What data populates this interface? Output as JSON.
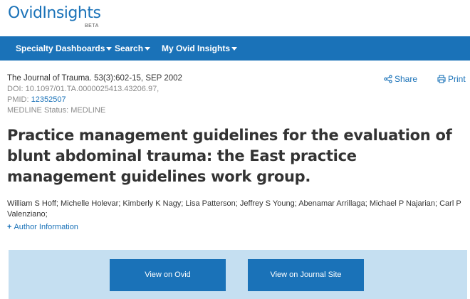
{
  "logo": {
    "text": "OvidInsights",
    "badge": "BETA"
  },
  "nav": {
    "items": [
      {
        "label": "Specialty Dashboards"
      },
      {
        "label": "Search"
      },
      {
        "label": "My Ovid Insights"
      }
    ]
  },
  "citation": {
    "journal": "The Journal of Trauma. 53(3):602-15, SEP 2002",
    "doi": "DOI: 10.1097/01.TA.0000025413.43206.97,",
    "pmid_label": "PMID:",
    "pmid_value": "12352507",
    "medline_status": "MEDLINE Status: MEDLINE"
  },
  "actions": {
    "share_label": "Share",
    "print_label": "Print"
  },
  "article": {
    "title": "Practice management guidelines for the evaluation of blunt abdominal trauma: the East practice management guidelines work group.",
    "authors": "William S Hoff; Michelle Holevar; Kimberly K Nagy; Lisa Patterson; Jeffrey S Young; Abenamar Arrillaga; Michael P Najarian; Carl P Valenziano;",
    "author_info_label": "Author Information"
  },
  "buttons": {
    "view_on_ovid": "View on Ovid",
    "view_on_journal": "View on Journal Site"
  },
  "colors": {
    "brand": "#1a72b8",
    "panel": "#c5dff1"
  },
  "icons": {
    "share": "share-icon",
    "print": "printer-icon",
    "expand": "plus-icon",
    "caret": "caret-down-icon"
  }
}
